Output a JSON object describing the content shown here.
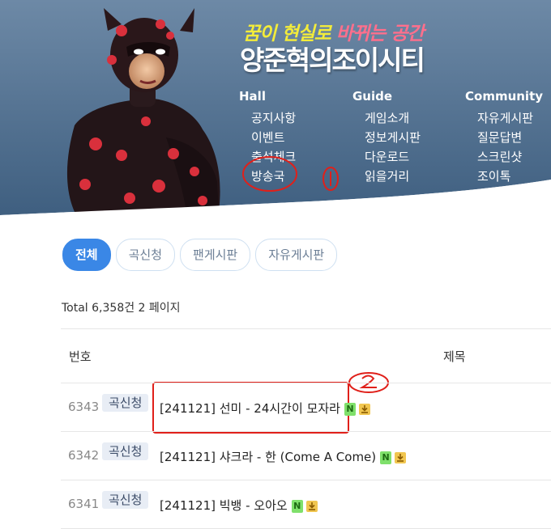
{
  "banner": {
    "tagline_a": "꿈이 현실로 ",
    "tagline_b": "바뀌는 공간",
    "site_name": "양준혁의조이시티",
    "nav": [
      {
        "heading": "Hall",
        "items": [
          "공지사항",
          "이벤트",
          "출석체크",
          "방송국"
        ]
      },
      {
        "heading": "Guide",
        "items": [
          "게임소개",
          "정보게시판",
          "다운로드",
          "읽을거리"
        ]
      },
      {
        "heading": "Community",
        "items": [
          "자유게시판",
          "질문답변",
          "스크린샷",
          "조이톡"
        ]
      }
    ]
  },
  "tabs": [
    "전체",
    "곡신청",
    "팬게시판",
    "자유게시판"
  ],
  "total_text": "Total 6,358건 2 페이지",
  "table": {
    "headers": {
      "number": "번호",
      "title": "제목"
    },
    "rows": [
      {
        "number": "6343",
        "category": "곡신청",
        "title": "[241121] 선미 - 24시간이 모자라",
        "new_badge": "N"
      },
      {
        "number": "6342",
        "category": "곡신청",
        "title": "[241121] 샤크라 - 한 (Come A Come)",
        "new_badge": "N"
      },
      {
        "number": "6341",
        "category": "곡신청",
        "title": "[241121] 빅뱅 - 오아오",
        "new_badge": "N"
      }
    ]
  },
  "icons": {
    "download": "download-icon",
    "new": "new-badge"
  },
  "colors": {
    "active_tab": "#3a87e6",
    "banner_bg": "#4e6d8e",
    "annotation": "#e0201a",
    "new_badge": "#7fe06b"
  }
}
